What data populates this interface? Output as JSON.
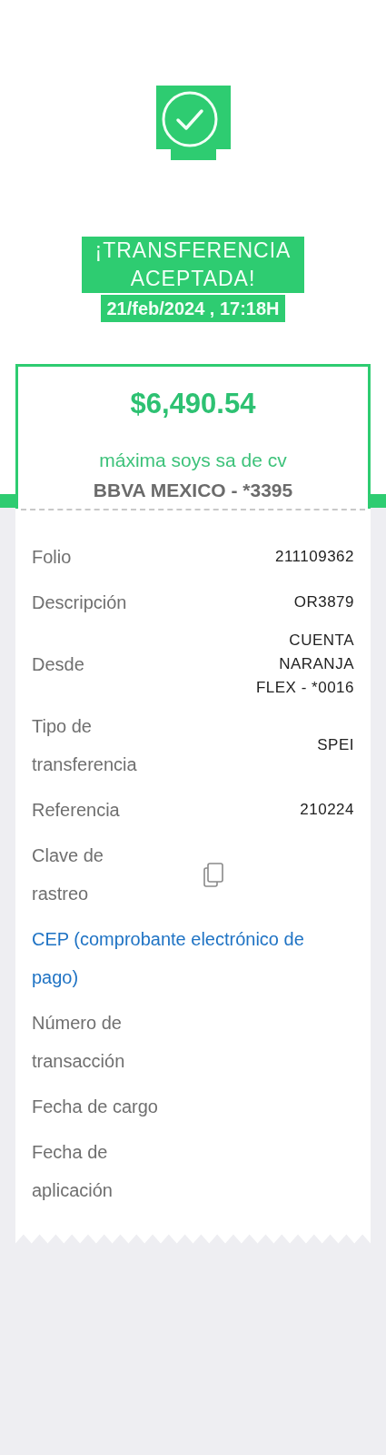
{
  "status": {
    "title": "¡TRANSFERENCIA ACEPTADA!",
    "datetime": "21/feb/2024 , 17:18H"
  },
  "summary": {
    "amount": "$6,490.54",
    "beneficiary": "máxima soys sa de cv",
    "bank": "BBVA MEXICO - *3395"
  },
  "details": [
    {
      "kind": "field",
      "label": "Folio",
      "value": "211109362"
    },
    {
      "kind": "field",
      "label": "Descripción",
      "value": "OR3879"
    },
    {
      "kind": "field",
      "label": "Desde",
      "value": "CUENTA NARANJA FLEX - *0016"
    },
    {
      "kind": "field",
      "label": "Tipo de transferencia",
      "value": "SPEI"
    },
    {
      "kind": "field",
      "label": "Referencia",
      "value": "210224"
    },
    {
      "kind": "copy",
      "label": "Clave de rastreo"
    },
    {
      "kind": "link",
      "label": "CEP (comprobante electrónico de pago)"
    },
    {
      "kind": "field",
      "label": "Número de transacción"
    },
    {
      "kind": "field",
      "label": "Fecha de cargo"
    },
    {
      "kind": "field",
      "label": "Fecha de aplicación"
    }
  ]
}
